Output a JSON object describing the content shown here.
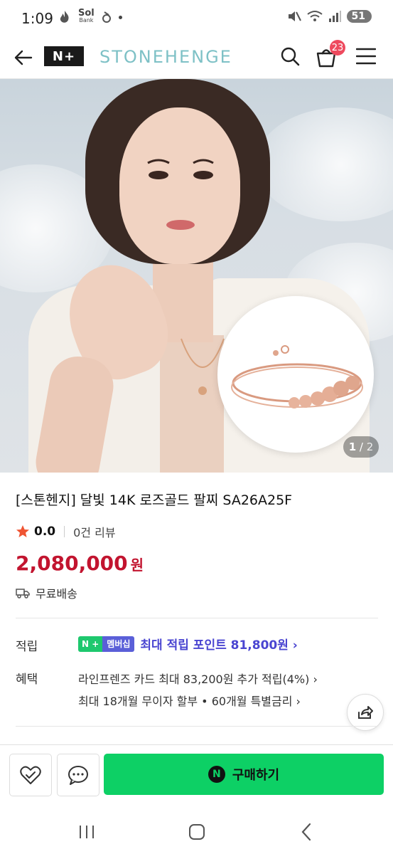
{
  "status_bar": {
    "time": "1:09",
    "sol_label": "Sol",
    "bank_label": "Bank",
    "battery": "51"
  },
  "header": {
    "logo": "N+",
    "brand": "STONEHENGE",
    "cart_count": "23"
  },
  "hero": {
    "page_current": "1",
    "page_total": "2"
  },
  "product": {
    "title": "[스톤헨지] 달빛 14K 로즈골드 팔찌 SA26A25F",
    "rating": "0.0",
    "reviews": "0건 리뷰",
    "price": "2,080,000",
    "price_unit": "원",
    "shipping": "무료배송"
  },
  "rewards": {
    "label": "적립",
    "badge_n": "N +",
    "badge_membership": "멤버십",
    "points_text": "최대 적립 포인트 81,800원 ›"
  },
  "benefits": {
    "label": "혜택",
    "line1": "라인프렌즈 카드 최대 83,200원 추가 적립(4%) ›",
    "line2": "최대 18개월 무이자 할부 • 60개월 특별금리 ›"
  },
  "actions": {
    "buy_label": "구매하기",
    "n_logo": "N"
  },
  "colors": {
    "price_red": "#c2142f",
    "buy_green": "#0dd065",
    "points_purple": "#4a45d1",
    "brand_teal": "#7ec1c6",
    "badge_red": "#ee4a5e"
  }
}
